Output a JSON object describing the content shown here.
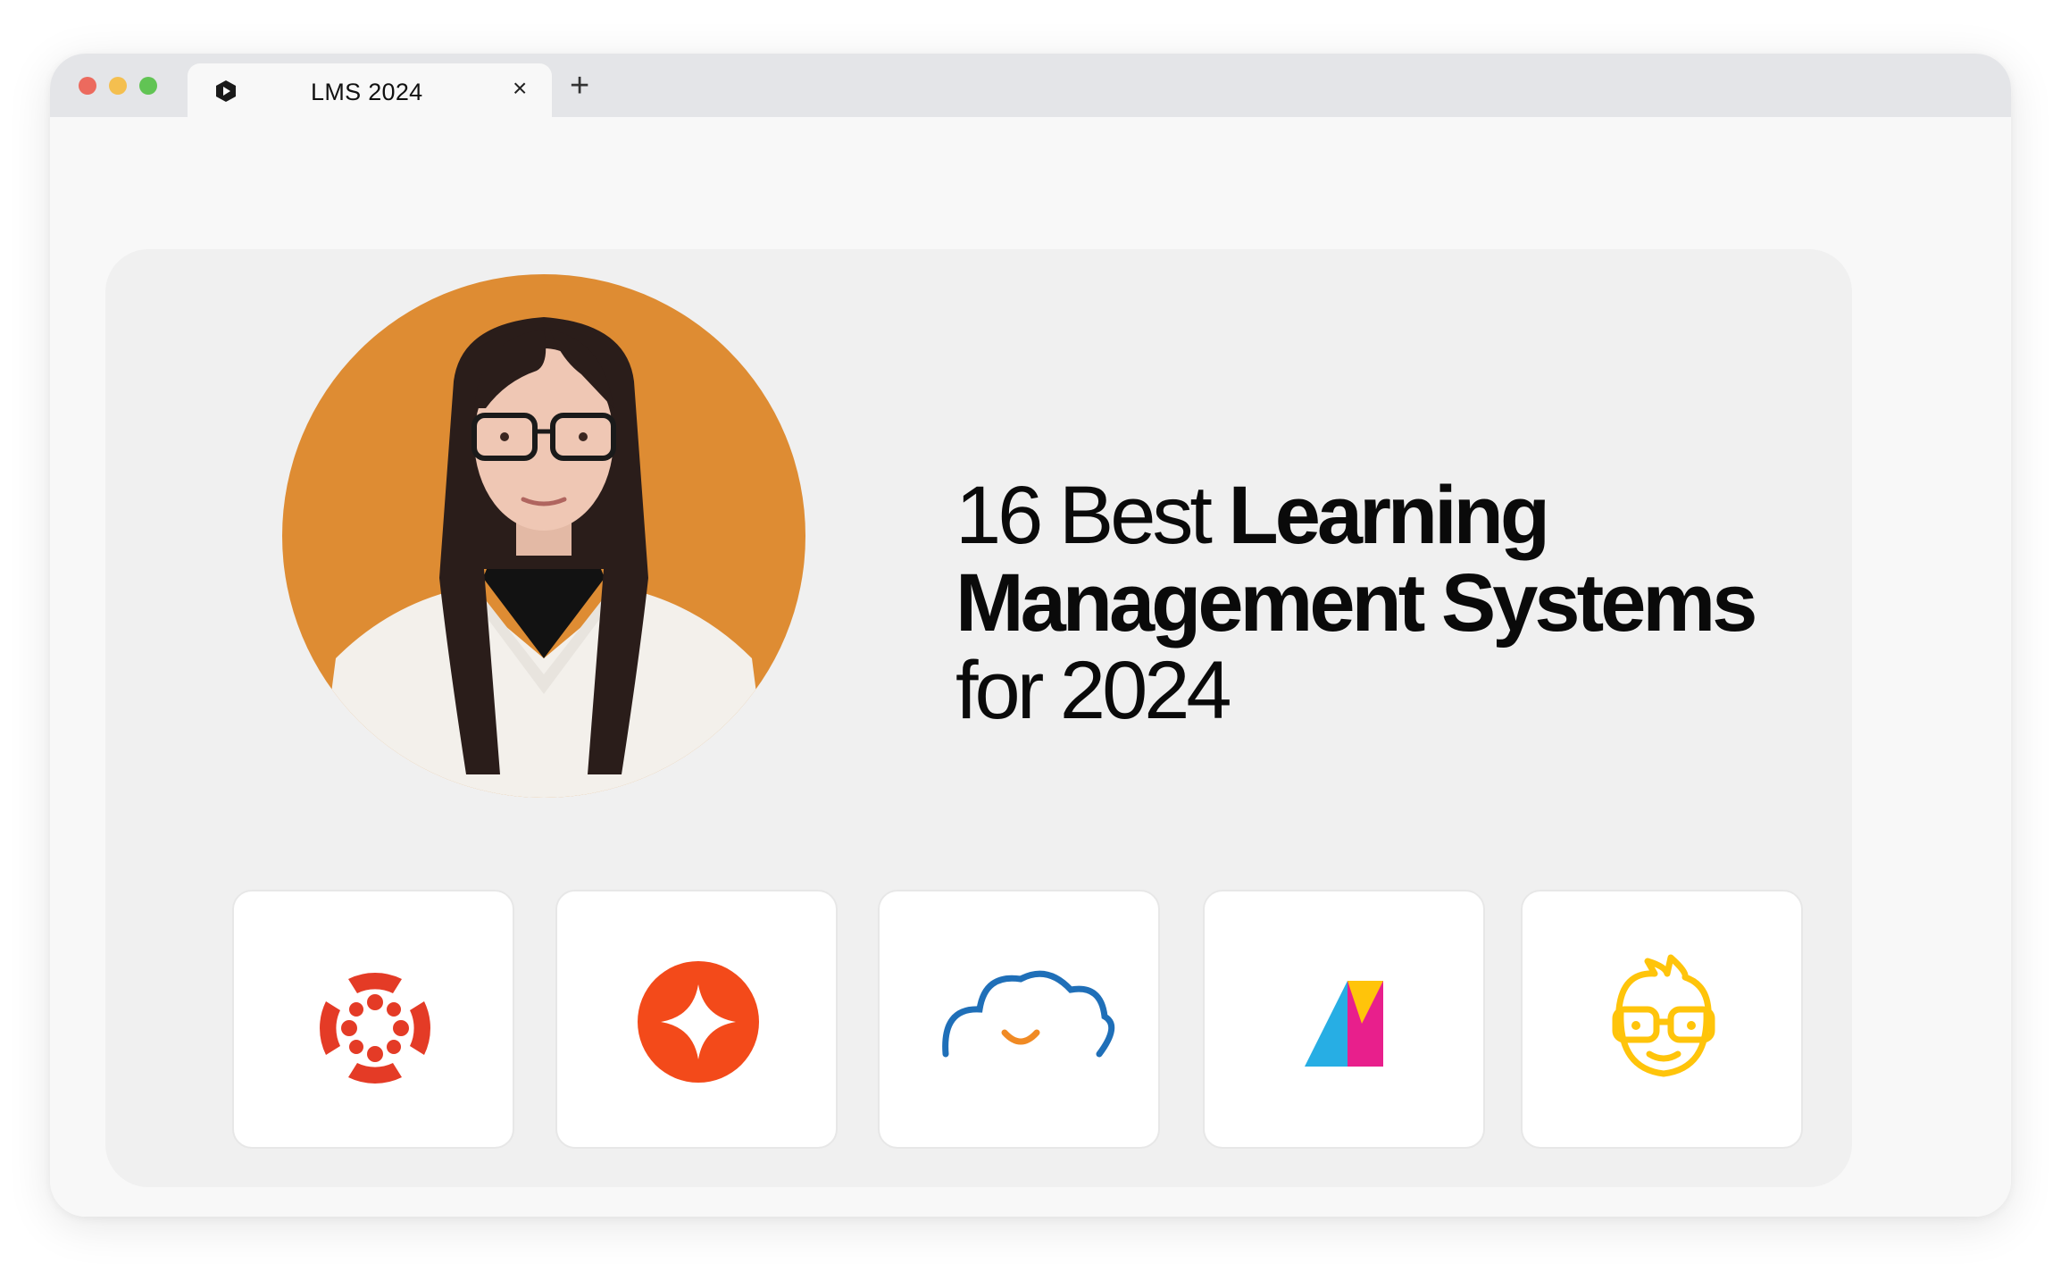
{
  "browser": {
    "tab": {
      "title": "LMS 2024",
      "favicon": "play-hexagon-icon",
      "close": "×"
    },
    "new_tab": "+"
  },
  "hero": {
    "avatar": "presenter-portrait",
    "avatar_bg": "#de8c33",
    "headline": {
      "line1_light": "16 Best ",
      "line1_bold": "Learning",
      "line2_bold": "Management Systems",
      "line3_light": "for 2024"
    }
  },
  "logos": [
    {
      "icon": "canvas-logo-icon",
      "color": "#e43b26"
    },
    {
      "icon": "sparkle-circle-logo-icon",
      "color": "#f34a1a"
    },
    {
      "icon": "cloud-smile-logo-icon",
      "color": "#1f6fb8"
    },
    {
      "icon": "a-mark-logo-icon",
      "color": "#e81f8c"
    },
    {
      "icon": "nerd-face-logo-icon",
      "color": "#ffc40a"
    }
  ]
}
